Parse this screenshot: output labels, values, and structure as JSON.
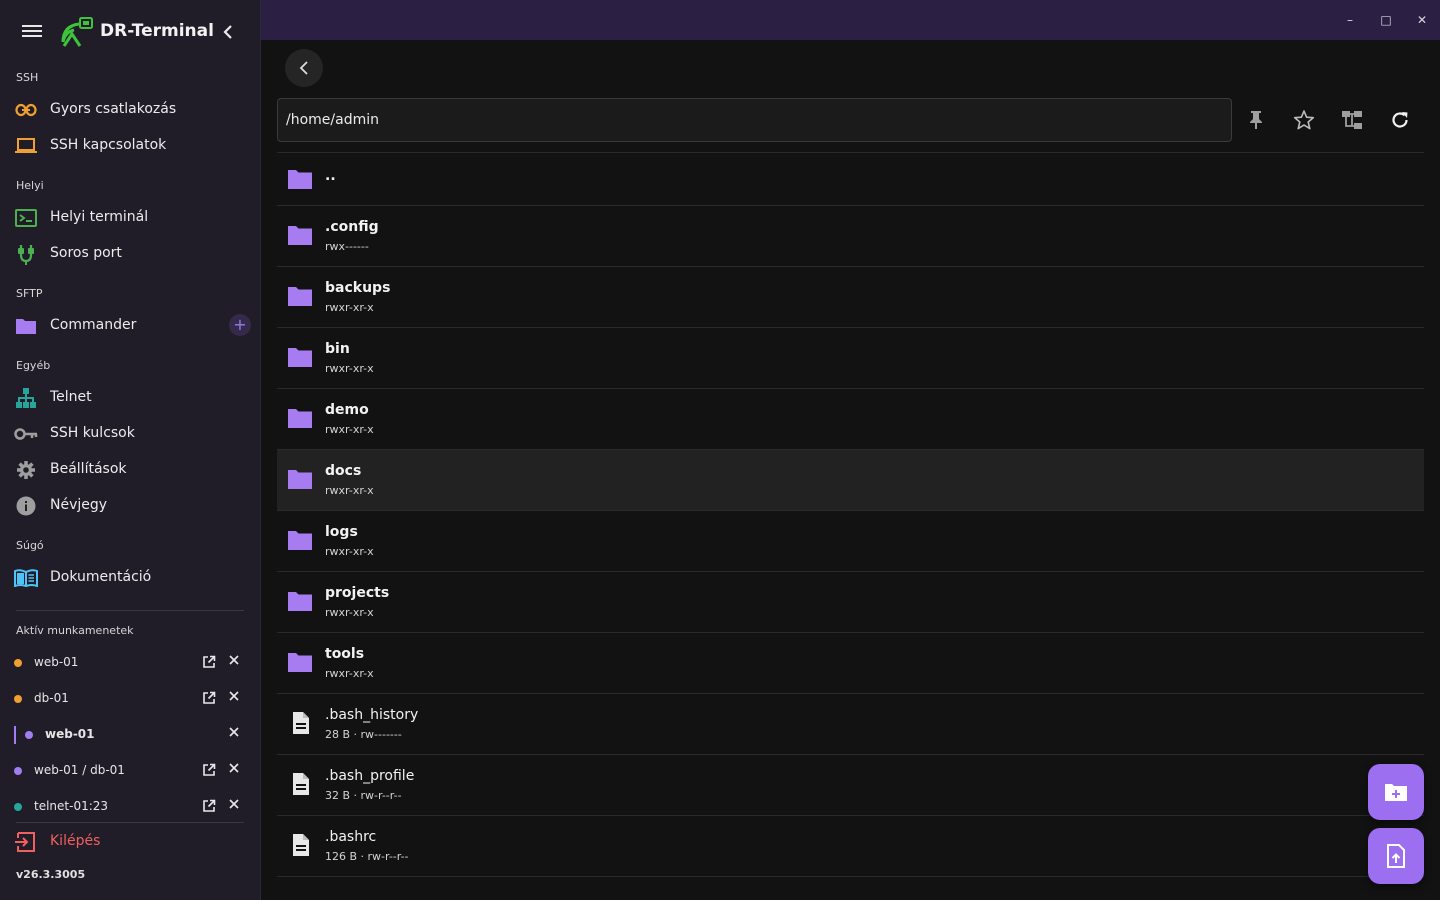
{
  "app": {
    "title": "DR-Terminal",
    "version": "v26.3.3005"
  },
  "colors": {
    "accent": "#9c6ef0",
    "folder": "#a77cf0",
    "logout": "#f0605e",
    "titlebar": "#2b1f44"
  },
  "sidebar": {
    "sections": {
      "ssh": "SSH",
      "local": "Helyi",
      "sftp": "SFTP",
      "other": "Egyéb",
      "help": "Súgó",
      "sessions": "Aktív munkamenetek"
    },
    "items": {
      "quick_connect": "Gyors csatlakozás",
      "ssh_connections": "SSH kapcsolatok",
      "local_terminal": "Helyi terminál",
      "serial_port": "Soros port",
      "commander": "Commander",
      "commander_add": "+",
      "telnet": "Telnet",
      "ssh_keys": "SSH kulcsok",
      "settings": "Beállítások",
      "about": "Névjegy",
      "docs": "Dokumentáció"
    },
    "sessions": [
      {
        "name": "web-01",
        "color": "#f0a030"
      },
      {
        "name": "db-01",
        "color": "#f0a030"
      },
      {
        "name": "web-01",
        "color": "#a07ef2"
      },
      {
        "name": "web-01 / db-01",
        "color": "#a07ef2"
      },
      {
        "name": "telnet-01:23",
        "color": "#26a69a"
      }
    ],
    "logout": "Kilépés"
  },
  "window": {
    "minimize": "–",
    "maximize": "□",
    "close": "✕"
  },
  "browser": {
    "path": "/home/admin",
    "entries": [
      {
        "name": "..",
        "meta": ""
      },
      {
        "name": ".config",
        "meta": "rwx------"
      },
      {
        "name": "backups",
        "meta": "rwxr-xr-x"
      },
      {
        "name": "bin",
        "meta": "rwxr-xr-x"
      },
      {
        "name": "demo",
        "meta": "rwxr-xr-x"
      },
      {
        "name": "docs",
        "meta": "rwxr-xr-x"
      },
      {
        "name": "logs",
        "meta": "rwxr-xr-x"
      },
      {
        "name": "projects",
        "meta": "rwxr-xr-x"
      },
      {
        "name": "tools",
        "meta": "rwxr-xr-x"
      },
      {
        "name": ".bash_history",
        "meta": "28 B · rw-------"
      },
      {
        "name": ".bash_profile",
        "meta": "32 B · rw-r--r--"
      },
      {
        "name": ".bashrc",
        "meta": "126 B · rw-r--r--"
      }
    ]
  },
  "icons": {
    "menu": "hamburger-icon",
    "collapse": "chevron-left-icon",
    "back": "chevron-left-icon",
    "pin": "pin-icon",
    "favorite": "star-icon",
    "tree": "tree-icon",
    "refresh": "refresh-icon",
    "new_folder": "create-folder-icon",
    "upload": "upload-file-icon"
  }
}
